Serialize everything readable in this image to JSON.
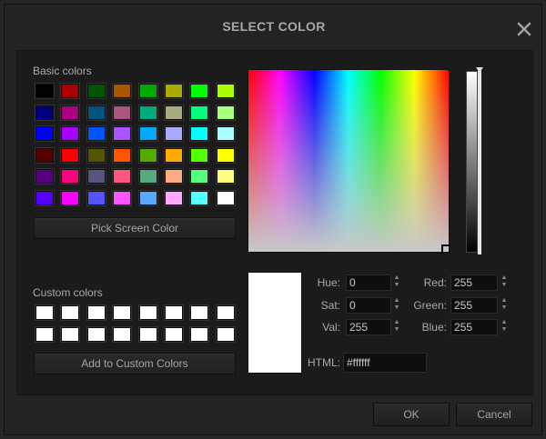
{
  "dialog": {
    "title": "SELECT COLOR",
    "close_icon": "close-icon"
  },
  "basic": {
    "label": "Basic colors",
    "rows": [
      [
        "#000000",
        "#aa0000",
        "#005500",
        "#aa5500",
        "#00aa00",
        "#aaaa00",
        "#00ff00",
        "#aaff00"
      ],
      [
        "#00007f",
        "#aa007f",
        "#00557f",
        "#aa557f",
        "#00aa7f",
        "#aaaa7f",
        "#00ff7f",
        "#aaff7f"
      ],
      [
        "#0000ff",
        "#aa00ff",
        "#0055ff",
        "#aa55ff",
        "#00aaff",
        "#aaaaff",
        "#00ffff",
        "#aaffff"
      ],
      [
        "#550000",
        "#ff0000",
        "#555500",
        "#ff5500",
        "#55aa00",
        "#ffaa00",
        "#55ff00",
        "#ffff00"
      ],
      [
        "#55007f",
        "#ff007f",
        "#55557f",
        "#ff557f",
        "#55aa7f",
        "#ffaa7f",
        "#55ff7f",
        "#ffff7f"
      ],
      [
        "#5500ff",
        "#ff00ff",
        "#5555ff",
        "#ff55ff",
        "#55aaff",
        "#ffaaff",
        "#55ffff",
        "#ffffff"
      ]
    ]
  },
  "pick_screen_label": "Pick Screen Color",
  "custom": {
    "label": "Custom colors",
    "rows": [
      [
        "#ffffff",
        "#ffffff",
        "#ffffff",
        "#ffffff",
        "#ffffff",
        "#ffffff",
        "#ffffff",
        "#ffffff"
      ],
      [
        "#ffffff",
        "#ffffff",
        "#ffffff",
        "#ffffff",
        "#ffffff",
        "#ffffff",
        "#ffffff",
        "#ffffff"
      ]
    ]
  },
  "add_custom_label": "Add to Custom Colors",
  "current_color": "#ffffff",
  "fields": {
    "hue": {
      "label": "Hue:",
      "value": "0"
    },
    "sat": {
      "label": "Sat:",
      "value": "0"
    },
    "val": {
      "label": "Val:",
      "value": "255"
    },
    "red": {
      "label": "Red:",
      "value": "255"
    },
    "green": {
      "label": "Green:",
      "value": "255"
    },
    "blue": {
      "label": "Blue:",
      "value": "255"
    },
    "html": {
      "label": "HTML:",
      "value": "#ffffff"
    }
  },
  "spin_up": "▲",
  "spin_down": "▼",
  "buttons": {
    "ok": "OK",
    "cancel": "Cancel"
  }
}
